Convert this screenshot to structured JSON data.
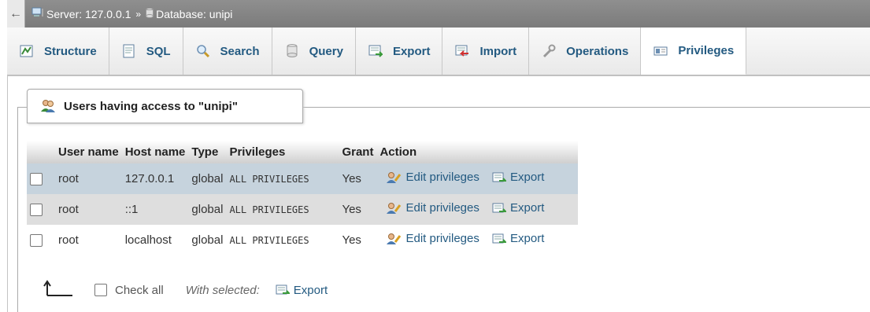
{
  "breadcrumb": {
    "back_icon": "arrow-left-icon",
    "server_label": "Server: 127.0.0.1",
    "separator": "»",
    "database_label": "Database: unipi"
  },
  "tabs": [
    {
      "label": "Structure",
      "icon": "structure-icon"
    },
    {
      "label": "SQL",
      "icon": "sql-icon"
    },
    {
      "label": "Search",
      "icon": "search-icon"
    },
    {
      "label": "Query",
      "icon": "query-icon"
    },
    {
      "label": "Export",
      "icon": "export-icon"
    },
    {
      "label": "Import",
      "icon": "import-icon"
    },
    {
      "label": "Operations",
      "icon": "wrench-icon"
    },
    {
      "label": "Privileges",
      "icon": "privileges-icon",
      "active": true
    }
  ],
  "section": {
    "title": "Users having access to \"unipi\""
  },
  "table": {
    "headers": [
      "User name",
      "Host name",
      "Type",
      "Privileges",
      "Grant",
      "Action"
    ],
    "rows": [
      {
        "user": "root",
        "host": "127.0.0.1",
        "type": "global",
        "privileges": "ALL PRIVILEGES",
        "grant": "Yes",
        "edit": "Edit privileges",
        "export": "Export"
      },
      {
        "user": "root",
        "host": "::1",
        "type": "global",
        "privileges": "ALL PRIVILEGES",
        "grant": "Yes",
        "edit": "Edit privileges",
        "export": "Export"
      },
      {
        "user": "root",
        "host": "localhost",
        "type": "global",
        "privileges": "ALL PRIVILEGES",
        "grant": "Yes",
        "edit": "Edit privileges",
        "export": "Export"
      }
    ]
  },
  "bottom": {
    "check_all": "Check all",
    "with_selected": "With selected:",
    "export": "Export"
  },
  "colors": {
    "link": "#235a81",
    "topbar": "#838383",
    "row_highlight": "#c6d3dd",
    "row_alt": "#dedede"
  }
}
